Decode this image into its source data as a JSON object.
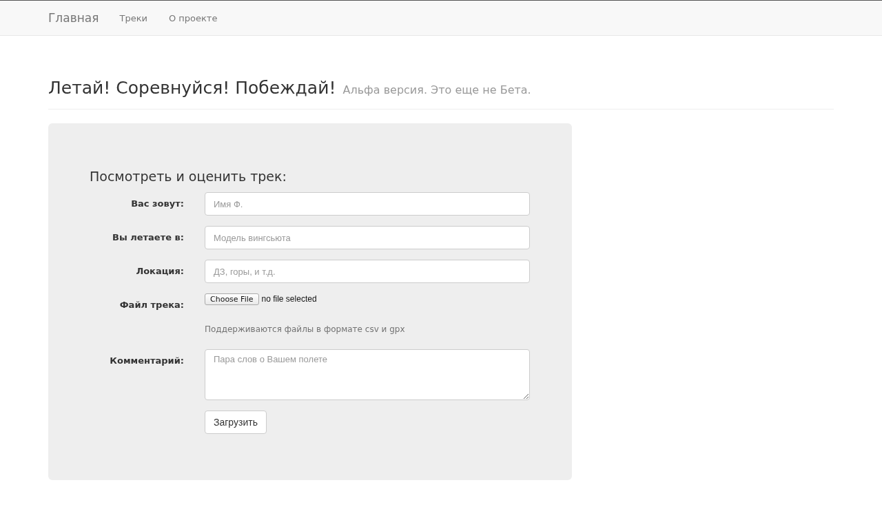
{
  "navbar": {
    "brand": "Главная",
    "links": [
      {
        "label": "Треки"
      },
      {
        "label": "О проекте"
      }
    ]
  },
  "header": {
    "title": "Летай! Соревнуйся! Побеждай!",
    "subtitle": "Альфа версия. Это еще не Бета."
  },
  "form": {
    "title": "Посмотреть и оценить трек:",
    "fields": [
      {
        "kind": "text",
        "label": "Вас зовут:",
        "placeholder": "Имя Ф."
      },
      {
        "kind": "text",
        "label": "Вы летаете в:",
        "placeholder": "Модель вингсьюта"
      },
      {
        "kind": "text",
        "label": "Локация:",
        "placeholder": "ДЗ, горы, и т.д."
      },
      {
        "kind": "file",
        "label": "Файл трека:",
        "button": "Choose File",
        "status": "no file selected",
        "help": "Поддерживаются файлы в формате csv и gpx"
      },
      {
        "kind": "textarea",
        "label": "Комментарий:",
        "placeholder": "Пара слов о Вашем полете"
      }
    ],
    "submit": "Загрузить"
  }
}
